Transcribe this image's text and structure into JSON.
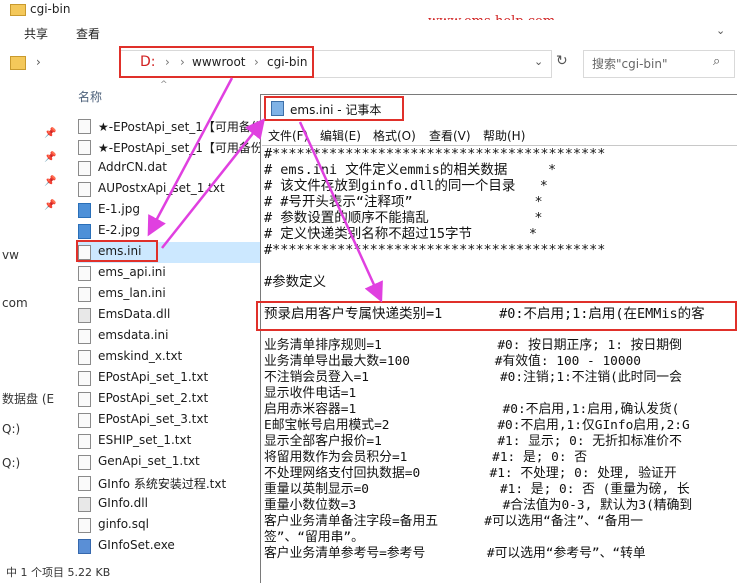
{
  "window": {
    "title": "cgi-bin",
    "watermark": "www.ems-help.com"
  },
  "ribbon": {
    "tabs": [
      "共享",
      "查看"
    ]
  },
  "address": {
    "drive": "D:",
    "sep": "›",
    "folder1": "wwwroot",
    "folder2": "cgi-bin",
    "search_placeholder": "搜索\"cgi-bin\""
  },
  "explorer": {
    "column_name": "名称",
    "left_nav": [
      "vw",
      "com",
      "数据盘 (E",
      "Q:)",
      "Q:)"
    ],
    "files": [
      {
        "name": "★-EPostApi_set_1【可用备份",
        "type": "txt"
      },
      {
        "name": "★-EPostApi_set_1【可用备份",
        "type": "txt"
      },
      {
        "name": "AddrCN.dat",
        "type": "txt"
      },
      {
        "name": "AUPostxApi_set_1.txt",
        "type": "txt"
      },
      {
        "name": "E-1.jpg",
        "type": "img"
      },
      {
        "name": "E-2.jpg",
        "type": "img"
      },
      {
        "name": "ems.ini",
        "type": "ini",
        "selected": true
      },
      {
        "name": "ems_api.ini",
        "type": "ini"
      },
      {
        "name": "ems_lan.ini",
        "type": "ini"
      },
      {
        "name": "EmsData.dll",
        "type": "dll"
      },
      {
        "name": "emsdata.ini",
        "type": "ini"
      },
      {
        "name": "emskind_x.txt",
        "type": "txt"
      },
      {
        "name": "EPostApi_set_1.txt",
        "type": "txt"
      },
      {
        "name": "EPostApi_set_2.txt",
        "type": "txt"
      },
      {
        "name": "EPostApi_set_3.txt",
        "type": "txt"
      },
      {
        "name": "ESHIP_set_1.txt",
        "type": "txt"
      },
      {
        "name": "GenApi_set_1.txt",
        "type": "txt"
      },
      {
        "name": "GInfo 系统安装过程.txt",
        "type": "txt"
      },
      {
        "name": "GInfo.dll",
        "type": "dll"
      },
      {
        "name": "ginfo.sql",
        "type": "txt"
      },
      {
        "name": "GInfoSet.exe",
        "type": "exe"
      }
    ],
    "status": "中 1 个项目   5.22 KB"
  },
  "notepad": {
    "title": "ems.ini - 记事本",
    "menu": [
      "文件(F)",
      "编辑(E)",
      "格式(O)",
      "查看(V)",
      "帮助(H)"
    ],
    "lines": [
      "#*****************************************",
      "# ems.ini 文件定义emmis的相关数据     *",
      "# 该文件存放到ginfo.dll的同一个目录   *",
      "# #号开头表示“注释项”               *",
      "# 参数设置的顺序不能搞乱             *",
      "# 定义快递类别名称不超过15字节       *",
      "#*****************************************",
      "",
      "#参数定义",
      "",
      "预录启用客户专属快递类别=1       #0:不启用;1:启用(在EMMis的客",
      "",
      "业务清单排序规则=1               #0: 按日期正序; 1: 按日期倒",
      "业务清单导出最大数=100           #有效值: 100 - 10000",
      "不注销会员登入=1                 #0:注销;1:不注销(此时同一会",
      "显示收件电话=1",
      "启用赤米容器=1                   #0:不启用,1:启用,确认发货(",
      "E邮宝帐号启用模式=2              #0:不启用,1:仅GInfo启用,2:G",
      "显示全部客户报价=1               #1: 显示; 0: 无折扣标准价不",
      "将留用数作为会员积分=1           #1: 是; 0: 否",
      "不处理网络支付回执数据=0         #1: 不处理; 0: 处理, 验证开",
      "重量以英制显示=0                 #1: 是; 0: 否 (重量为磅, 长",
      "重量小数位数=3                   #合法值为0-3, 默认为3(精确到",
      "客户业务清单备注字段=备用五      #可以选用“备注”、“备用一",
      "签”、“留用串”。",
      "客户业务清单参考号=参考号        #可以选用“参考号”、“转单"
    ]
  }
}
